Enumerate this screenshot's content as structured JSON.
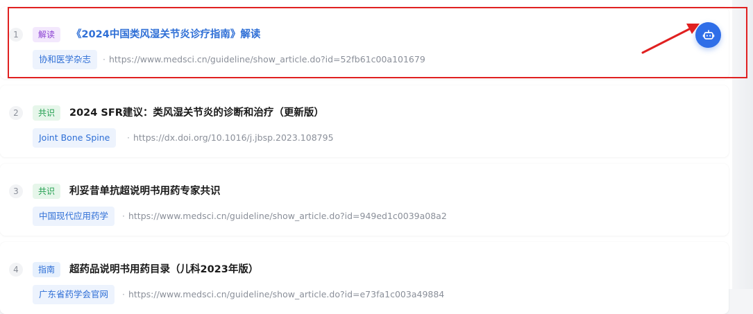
{
  "colors": {
    "accent": "#2f6ee8",
    "annotation_red": "#e02020",
    "tag_purple": "#8a3fd1",
    "tag_green": "#1f9d4d",
    "tag_blue": "#2f6fd6"
  },
  "results": [
    {
      "index": "1",
      "tag": "解读",
      "tag_color": "purple",
      "title": "《2024中国类风湿关节炎诊疗指南》解读",
      "source": "协和医学杂志",
      "url": "https://www.medsci.cn/guideline/show_article.do?id=52fb61c00a101679"
    },
    {
      "index": "2",
      "tag": "共识",
      "tag_color": "green",
      "title": "2024 SFR建议：类风湿关节炎的诊断和治疗（更新版）",
      "source": "Joint Bone Spine",
      "url": "https://dx.doi.org/10.1016/j.jbsp.2023.108795"
    },
    {
      "index": "3",
      "tag": "共识",
      "tag_color": "green",
      "title": "利妥昔单抗超说明书用药专家共识",
      "source": "中国现代应用药学",
      "url": "https://www.medsci.cn/guideline/show_article.do?id=949ed1c0039a08a2"
    },
    {
      "index": "4",
      "tag": "指南",
      "tag_color": "blue",
      "title": "超药品说明书用药目录（儿科2023年版）",
      "source": "广东省药学会官网",
      "url": "https://www.medsci.cn/guideline/show_article.do?id=e73fa1c003a49884"
    }
  ],
  "url_separator": "·",
  "ai_button_icon": "robot-icon",
  "annotation": {
    "type": "red-highlight-box-and-arrow",
    "target": "ai-assistant-button"
  }
}
